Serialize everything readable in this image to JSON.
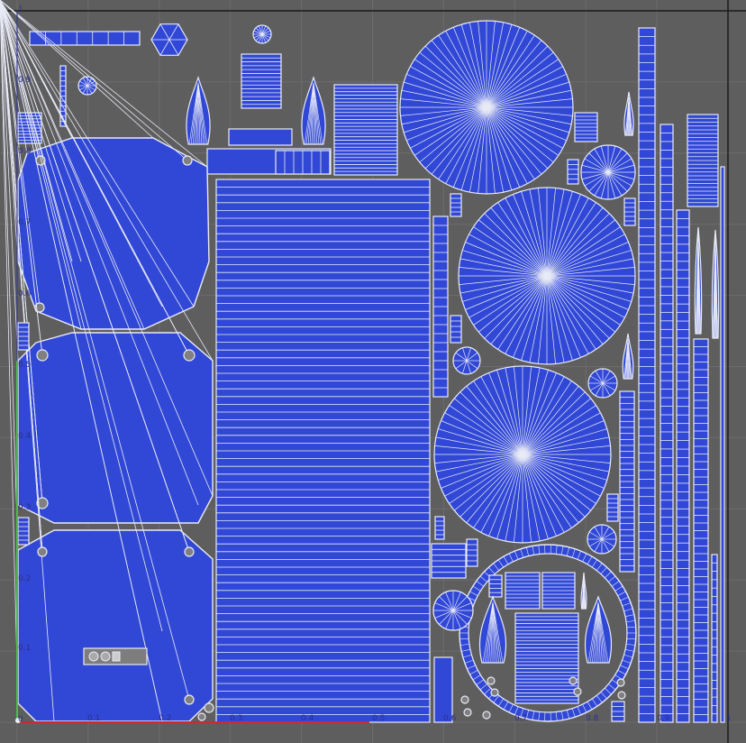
{
  "app": {
    "view": "UV Editor"
  },
  "axis": {
    "y_labels": [
      "1",
      "0.9",
      "0.8",
      "0.7",
      "0.6",
      "0.5",
      "0.4",
      "0.3",
      "0.2",
      "0.1",
      "0"
    ],
    "x_labels": [
      "0.1",
      "0.2",
      "0.3",
      "0.4",
      "0.5",
      "0.6",
      "0.7",
      "0.8",
      "0.9",
      "1"
    ]
  },
  "colors": {
    "background": "#5e5e5e",
    "uv_fill": "#3148d6",
    "edge": "#e8eaf6",
    "grid": "#6c6c6c",
    "v_axis": "#46c046",
    "u_axis": "#c03030",
    "bound": "#1a1a1a"
  },
  "icons": [
    "uv-island-fan",
    "uv-island-strip"
  ]
}
